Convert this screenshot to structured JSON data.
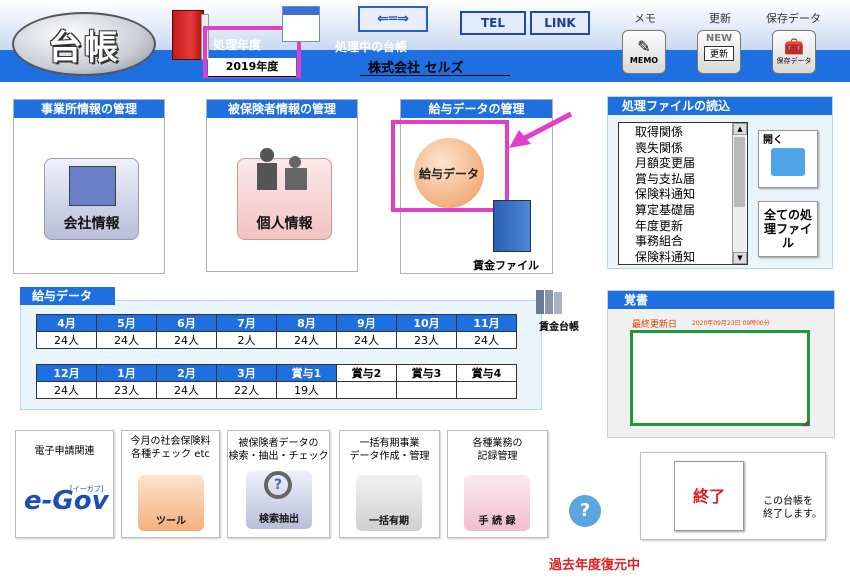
{
  "app": {
    "logo_text": "台帳"
  },
  "header": {
    "year_label": "処理年度",
    "year_value": "2019年度",
    "processing_label": "処理中の台帳",
    "company_name": "株式会社 セルズ",
    "tel_label": "TEL",
    "link_label": "LINK",
    "memo_label": "メモ",
    "memo_icon_text": "MEMO",
    "update_label": "更新",
    "update_icon_text": "NEW",
    "update_icon_sub": "更新",
    "save_label": "保存データ",
    "save_icon_text": "保存データ"
  },
  "office": {
    "title": "事業所情報の管理",
    "button_label": "会社情報"
  },
  "insured": {
    "title": "被保険者情報の管理",
    "button_label": "個人情報"
  },
  "salary_mgmt": {
    "title": "給与データの管理",
    "button_label": "給与データ",
    "wage_file_label": "賃金ファイル"
  },
  "process_files": {
    "title": "処理ファイルの読込",
    "items": [
      "取得関係",
      "喪失関係",
      "月額変更届",
      "賞与支払届",
      "保険料通知",
      "算定基礎届",
      "年度更新",
      "事務組合",
      "保険料通知"
    ],
    "open_label": "開く",
    "all_files_label": "全ての処理ファイル"
  },
  "salary_data": {
    "title": "給与データ",
    "row1_headers": [
      "4月",
      "5月",
      "6月",
      "7月",
      "8月",
      "9月",
      "10月",
      "11月"
    ],
    "row1_values": [
      "24人",
      "24人",
      "24人",
      "2人",
      "24人",
      "24人",
      "23人",
      "24人"
    ],
    "row2_headers": [
      "12月",
      "1月",
      "2月",
      "3月",
      "賞与1",
      "賞与2",
      "賞与3",
      "賞与4"
    ],
    "row2_values": [
      "24人",
      "23人",
      "24人",
      "22人",
      "19人",
      "",
      "",
      ""
    ],
    "ledger_label": "賃金台帳"
  },
  "memo": {
    "title": "覚書",
    "last_updated_label": "最終更新日",
    "last_updated_value": "2020年09月23日 09時00分"
  },
  "bottom": {
    "egov_title": "電子申請関連",
    "egov_logo": "e-Gov",
    "egov_kana": "[イーガブ]",
    "tools_title": "今月の社会保険料\n各種チェック etc",
    "tools_label": "ツール",
    "extract_title": "被保険者データの\n検索・抽出・チェック",
    "extract_label": "検索抽出",
    "bulk_title": "一括有期事業\nデータ作成・管理",
    "bulk_label": "一括有期",
    "records_title": "各種業務の\n記録管理",
    "records_label": "手 続 録",
    "help_label": "?"
  },
  "exit": {
    "button_label": "終了",
    "description": "この台帳を\n終了します。"
  },
  "status": {
    "restore_text": "過去年度復元中"
  },
  "colors": {
    "accent_blue": "#1e6fe0",
    "highlight_magenta": "#e040c8",
    "exit_red": "#e02020"
  }
}
